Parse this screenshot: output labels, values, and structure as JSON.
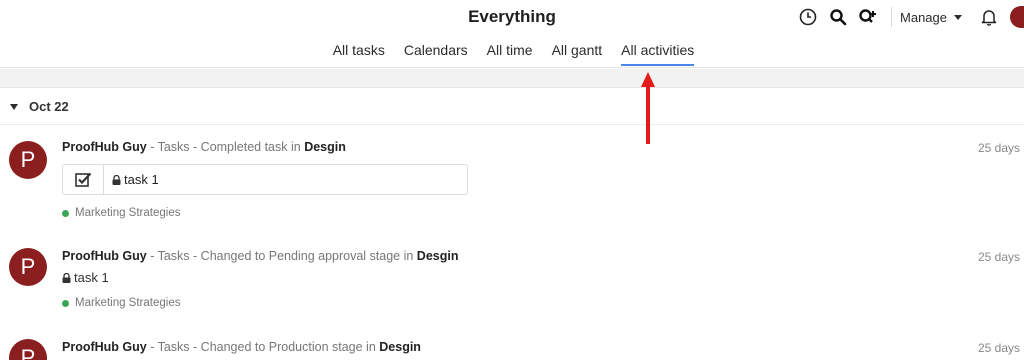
{
  "header": {
    "title": "Everything",
    "tabs": [
      "All tasks",
      "Calendars",
      "All time",
      "All gantt",
      "All activities"
    ],
    "active_tab": "All activities",
    "manage_label": "Manage"
  },
  "date_group": "Oct 22",
  "colors": {
    "accent": "#4a86e8",
    "avatar": "#8b1f1f",
    "tag_dot": "#3aa657",
    "arrow": "#e21b1b"
  },
  "activities": [
    {
      "avatar_letter": "P",
      "user": "ProofHub Guy",
      "action": " - Tasks - Completed task in ",
      "project": "Desgin",
      "time": "25 days",
      "task": "task 1",
      "tag": "Marketing Strategies"
    },
    {
      "avatar_letter": "P",
      "user": "ProofHub Guy",
      "action": " - Tasks - Changed to Pending approval stage in ",
      "project": "Desgin",
      "time": "25 days",
      "task": "task 1",
      "tag": "Marketing Strategies"
    },
    {
      "avatar_letter": "P",
      "user": "ProofHub Guy",
      "action": " - Tasks - Changed to Production stage in ",
      "project": "Desgin",
      "time": "25 days"
    }
  ]
}
